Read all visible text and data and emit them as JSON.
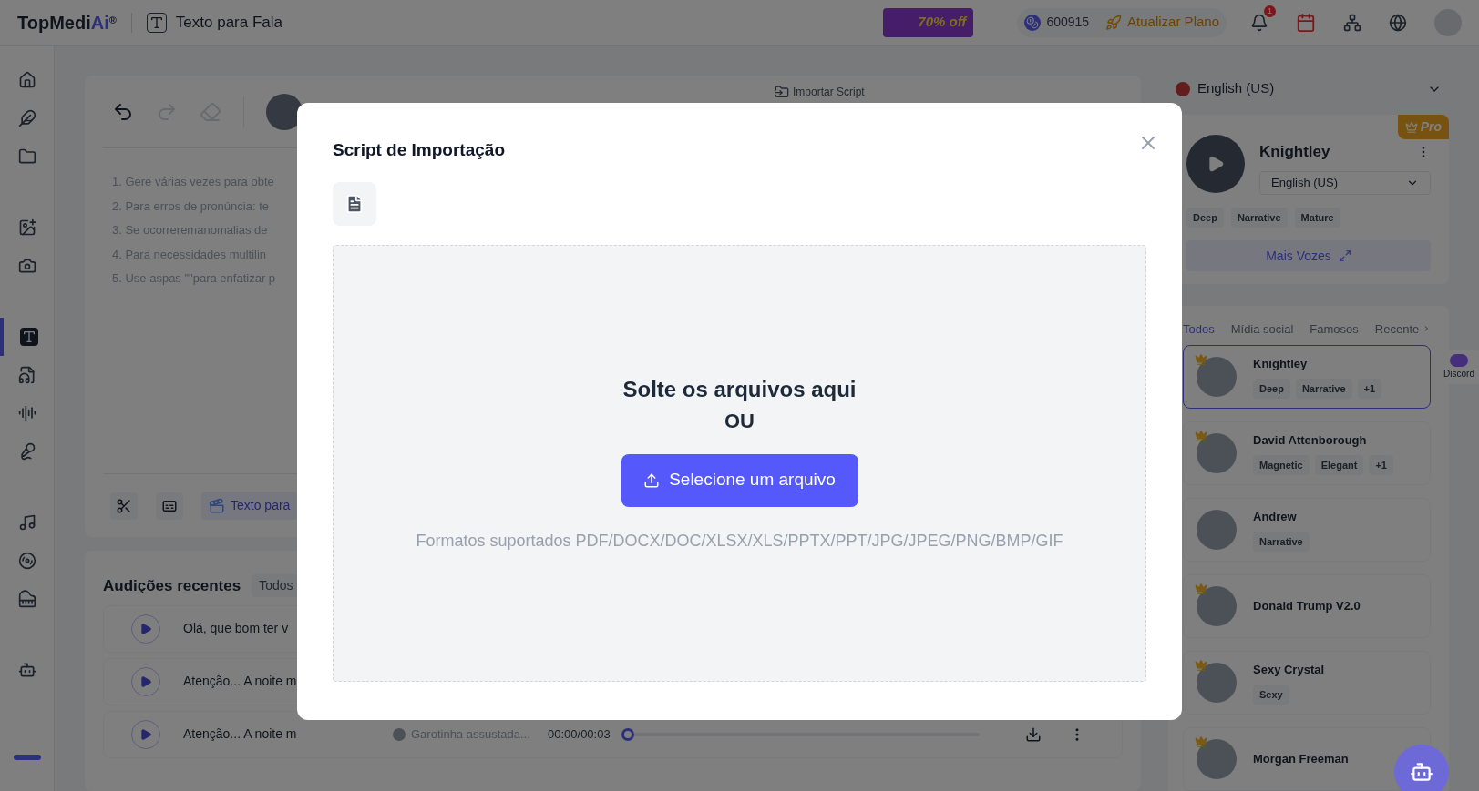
{
  "topbar": {
    "logo": {
      "text": "TopMedi",
      "accent": "Ai",
      "mark": "®"
    },
    "page_title": "Texto para Fala",
    "promo": "70% off",
    "credits": "600915",
    "upgrade": "Atualizar Plano",
    "notification_count": "1"
  },
  "sidebar": {
    "groups": [
      {
        "items": [
          {
            "selected": false
          },
          {
            "selected": false
          },
          {
            "selected": false
          }
        ]
      },
      {
        "items": [
          {
            "selected": false
          },
          {
            "selected": false
          }
        ]
      },
      {
        "items": [
          {
            "selected": true
          },
          {
            "selected": false
          },
          {
            "selected": false
          },
          {
            "selected": false
          }
        ]
      },
      {
        "items": [
          {
            "selected": false
          },
          {
            "selected": false
          },
          {
            "selected": false
          }
        ]
      },
      {
        "items": [
          {
            "selected": false
          }
        ]
      }
    ]
  },
  "editor": {
    "tools": [
      {
        "kind": "undo",
        "disabled": false
      },
      {
        "kind": "redo",
        "disabled": true
      },
      {
        "kind": "eraser",
        "disabled": true
      }
    ],
    "import_label": "Importar Script",
    "hint_lines": [
      "1. Gere várias vezes para obte",
      "2. Para erros de pronúncia: te",
      "3. Se ocorreremanomalias de",
      "4. Para necessidades multilin",
      "5. Use aspas \"\"para enfatizar p"
    ],
    "bottom_mode": "Texto para"
  },
  "recent": {
    "title": "Audições recentes",
    "filter": "Todos",
    "rows": [
      {
        "text": "Olá, que bom ter v"
      },
      {
        "text": "Atenção... A noite m"
      },
      {
        "text": "Atenção... A noite m",
        "voice": "Garotinha assustada...",
        "time": "00:00/00:03",
        "level": 0
      }
    ]
  },
  "voice_panel": {
    "language": "English (US)",
    "current": {
      "name": "Knightley",
      "badge": "Pro",
      "language": "English (US)",
      "tags": [
        "Deep",
        "Narrative",
        "Mature"
      ],
      "more_button": "Mais Vozes"
    },
    "tabs": [
      {
        "label": "Todos",
        "selected": true
      },
      {
        "label": "Mídia social",
        "selected": false
      },
      {
        "label": "Famosos",
        "selected": false
      },
      {
        "label": "Recente",
        "selected": false
      }
    ],
    "voices": [
      {
        "name": "Knightley",
        "tags": [
          "Deep",
          "Narrative",
          "+1"
        ],
        "premium": true,
        "selected": true
      },
      {
        "name": "David Attenborough",
        "tags": [
          "Magnetic",
          "Elegant",
          "+1"
        ],
        "premium": true,
        "selected": false
      },
      {
        "name": "Andrew",
        "tags": [
          "Narrative"
        ],
        "premium": false,
        "selected": false
      },
      {
        "name": "Donald Trump V2.0",
        "premium": true,
        "selected": false
      },
      {
        "name": "Sexy Crystal",
        "tags": [
          "Sexy"
        ],
        "premium": true,
        "selected": false
      },
      {
        "name": "Morgan Freeman",
        "premium": true,
        "selected": false
      }
    ]
  },
  "discord_float": {
    "label": "Discord"
  },
  "modal": {
    "title": "Script de Importação",
    "drop_title": "Solte os arquivos aqui",
    "drop_or": "OU",
    "select_button": "Selecione um arquivo",
    "formats": "Formatos suportados PDF/DOCX/DOC/XLSX/XLS/PPTX/PPT/JPG/JPEG/PNG/BMP/GIF"
  }
}
